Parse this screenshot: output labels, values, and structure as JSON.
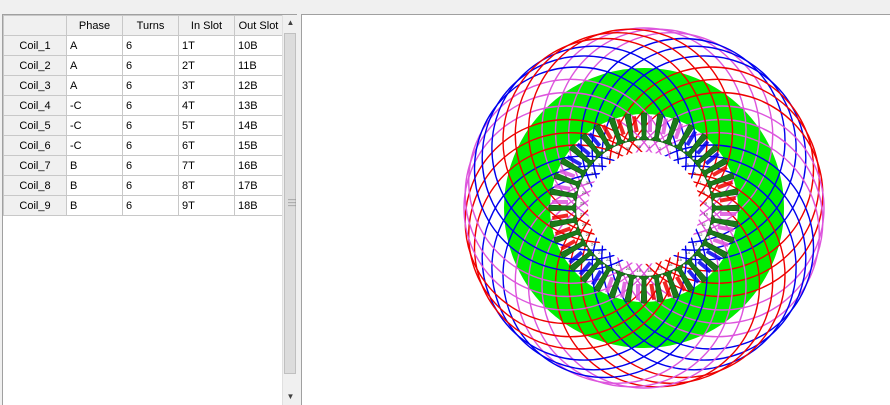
{
  "grid": {
    "columns": [
      "",
      "Phase",
      "Turns",
      "In Slot",
      "Out Slot"
    ],
    "rows": [
      {
        "name": "Coil_1",
        "phase": "A",
        "turns": "6",
        "in": "1T",
        "out": "10B"
      },
      {
        "name": "Coil_2",
        "phase": "A",
        "turns": "6",
        "in": "2T",
        "out": "11B"
      },
      {
        "name": "Coil_3",
        "phase": "A",
        "turns": "6",
        "in": "3T",
        "out": "12B"
      },
      {
        "name": "Coil_4",
        "phase": "-C",
        "turns": "6",
        "in": "4T",
        "out": "13B"
      },
      {
        "name": "Coil_5",
        "phase": "-C",
        "turns": "6",
        "in": "5T",
        "out": "14B"
      },
      {
        "name": "Coil_6",
        "phase": "-C",
        "turns": "6",
        "in": "6T",
        "out": "15B"
      },
      {
        "name": "Coil_7",
        "phase": "B",
        "turns": "6",
        "in": "7T",
        "out": "16B"
      },
      {
        "name": "Coil_8",
        "phase": "B",
        "turns": "6",
        "in": "8T",
        "out": "17B"
      },
      {
        "name": "Coil_9",
        "phase": "B",
        "turns": "6",
        "in": "9T",
        "out": "18B"
      }
    ]
  },
  "scrollbar": {
    "up_icon": "arrow-up-icon",
    "down_icon": "arrow-down-icon"
  },
  "diagram": {
    "slot_count": 36,
    "colors": {
      "stator": "#00ee00",
      "tooth": "#1a7a1a",
      "phase_a": "#dd55dd",
      "phase_b": "#0000ee",
      "phase_c": "#ee0000"
    }
  }
}
